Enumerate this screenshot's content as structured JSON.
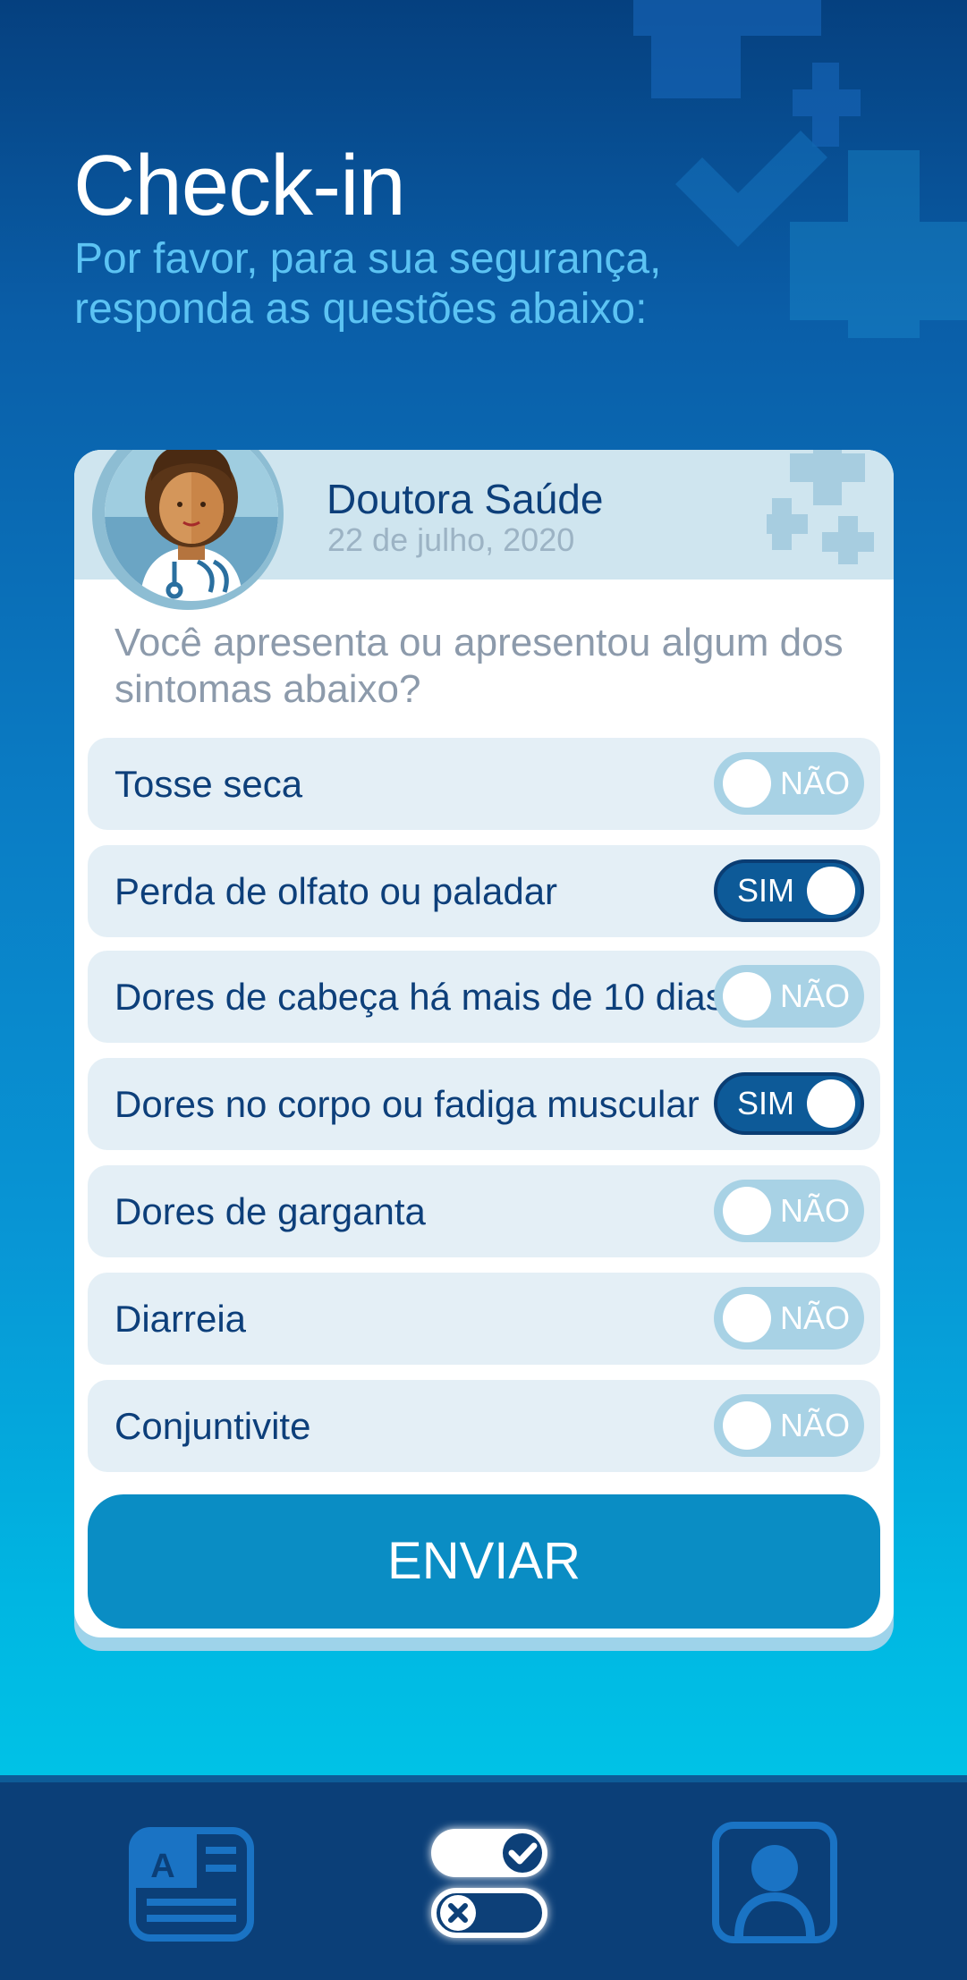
{
  "header": {
    "title": "Check-in",
    "subtitle": "Por favor, para sua segurança,\nresponda as questões abaixo:"
  },
  "card": {
    "doctor_name": "Doutora Saúde",
    "date": "22 de julho, 2020",
    "question": "Você apresenta ou apresentou algum dos sintomas abaixo?",
    "symptoms": [
      {
        "label": "Tosse seca",
        "state": "NÃO"
      },
      {
        "label": "Perda de olfato ou paladar",
        "state": "SIM"
      },
      {
        "label": "Dores de cabeça há mais de 10 dias",
        "state": "NÃO"
      },
      {
        "label": "Dores no corpo ou fadiga muscular",
        "state": "SIM"
      },
      {
        "label": "Dores de garganta",
        "state": "NÃO"
      },
      {
        "label": "Diarreia",
        "state": "NÃO"
      },
      {
        "label": "Conjuntivite",
        "state": "NÃO"
      }
    ],
    "submit_label": "ENVIAR"
  },
  "bottom_nav": {
    "items": [
      {
        "icon": "document-icon",
        "active": false
      },
      {
        "icon": "checklist-toggle-icon",
        "active": true
      },
      {
        "icon": "profile-icon",
        "active": false
      }
    ]
  },
  "colors": {
    "primary_dark": "#0d3f7a",
    "accent": "#0a8dc4",
    "toggle_on": "#0d5a98",
    "toggle_off": "#a8d2e5",
    "subtitle": "#5cc3f3"
  }
}
